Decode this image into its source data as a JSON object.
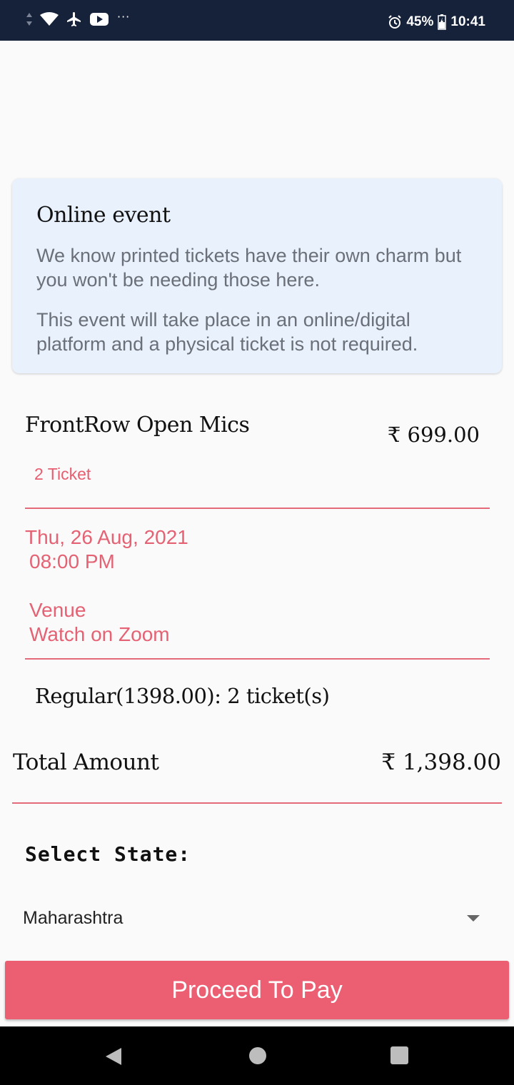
{
  "status_bar": {
    "battery": "45%",
    "time": "10:41",
    "more": "···"
  },
  "info_card": {
    "title": "Online event",
    "line1": "We know printed tickets have their own charm but you won't be needing those here.",
    "line2": "This event will take place in an online/digital platform and a physical ticket is not required."
  },
  "event": {
    "name": "FrontRow Open Mics",
    "price": "₹  699.00",
    "tickets": "2 Ticket",
    "date": "Thu, 26 Aug, 2021",
    "time": "08:00 PM",
    "venue_label": "Venue",
    "venue_value": "Watch on Zoom"
  },
  "summary": {
    "regular": "Regular(1398.00): 2 ticket(s)",
    "total_label": "Total Amount",
    "total_value": "₹ 1,398.00"
  },
  "state": {
    "label": "Select State:",
    "selected": "Maharashtra"
  },
  "actions": {
    "pay": "Proceed To Pay"
  },
  "colors": {
    "accent": "#ec5f73",
    "status_bar": "#15223a",
    "card_bg": "#e9f1fd"
  }
}
